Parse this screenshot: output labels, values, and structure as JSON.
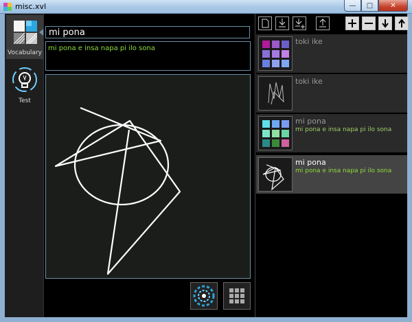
{
  "window": {
    "title": "misc.xvl"
  },
  "sidebar": {
    "items": [
      {
        "label": "Vocabulary"
      },
      {
        "label": "Test"
      }
    ]
  },
  "editor": {
    "word": "mi pona",
    "definition": "mi pona e insa napa pi ilo sona"
  },
  "entries": [
    {
      "word": "toki ike",
      "definition": ""
    },
    {
      "word": "toki ike",
      "definition": ""
    },
    {
      "word": "mi pona",
      "definition": "mi pona e insa napa pi ilo sona"
    },
    {
      "word": "mi pona",
      "definition": "mi pona e insa napa pi ilo sona"
    }
  ],
  "colors": {
    "accent_border": "#6b8fa8",
    "definition_text": "#8fdc3a",
    "background": "#000000"
  }
}
